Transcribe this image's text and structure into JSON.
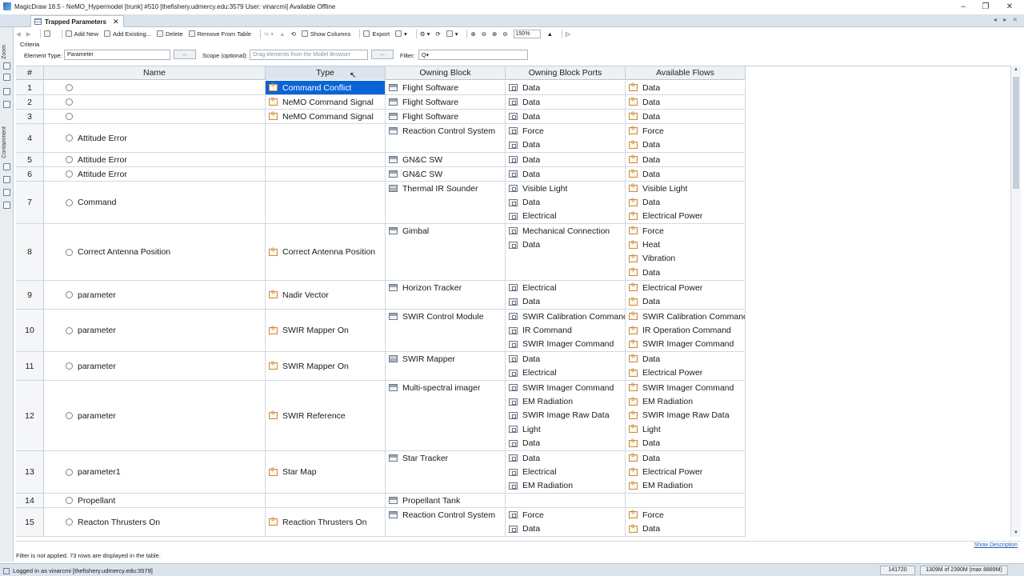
{
  "window": {
    "title": "MagicDraw 18.5 - NeMO_Hypermodel [trunk] #510  [thefishery.udmercy.edu:3579 User: vinarcmi] Available Offline",
    "controls": [
      "–",
      "❐",
      "✕"
    ]
  },
  "tab": {
    "label": "Trapped Parameters",
    "close": "✕"
  },
  "tabnav": "◂ ▸ ≡",
  "leftdock": {
    "zoom_label": "Zoom",
    "containment_label": "Containment"
  },
  "toolbar": {
    "add_new": "Add New",
    "add_existing": "Add Existing...",
    "delete": "Delete",
    "remove_from_table": "Remove From Table",
    "show_columns": "Show Columns",
    "export": "Export",
    "zoom": "150%"
  },
  "criteria": {
    "label": "Criteria",
    "element_type_label": "Element Type:",
    "element_type_value": "Parameter",
    "browse_button": "...",
    "scope_label": "Scope (optional):",
    "scope_placeholder": "Drag elements from the Model Browser",
    "scope_button": "...",
    "filter_label": "Filter:",
    "filter_value": "Q▾"
  },
  "table": {
    "columns": [
      "#",
      "Name",
      "Type",
      "Owning Block",
      "Owning Block Ports",
      "Available Flows"
    ],
    "rows": [
      {
        "num": "1",
        "name": "",
        "type": "Command Conflict",
        "type_icon": "signal",
        "selected": true,
        "block": [
          {
            "icon": "block",
            "text": "Flight Software"
          }
        ],
        "ports": [
          {
            "icon": "port",
            "text": "Data"
          }
        ],
        "flows": [
          {
            "icon": "flow",
            "text": "Data"
          }
        ]
      },
      {
        "num": "2",
        "name": "",
        "type": "NeMO Command Signal",
        "type_icon": "signal",
        "block": [
          {
            "icon": "block",
            "text": "Flight Software"
          }
        ],
        "ports": [
          {
            "icon": "port",
            "text": "Data"
          }
        ],
        "flows": [
          {
            "icon": "flow",
            "text": "Data"
          }
        ]
      },
      {
        "num": "3",
        "name": "",
        "type": "NeMO Command Signal",
        "type_icon": "signal",
        "block": [
          {
            "icon": "block",
            "text": "Flight Software"
          }
        ],
        "ports": [
          {
            "icon": "port",
            "text": "Data"
          }
        ],
        "flows": [
          {
            "icon": "flow",
            "text": "Data"
          }
        ]
      },
      {
        "num": "4",
        "name": "Attitude Error",
        "type": "",
        "type_icon": "",
        "block": [
          {
            "icon": "block",
            "text": "Reaction Control System"
          }
        ],
        "ports": [
          {
            "icon": "port",
            "text": "Force"
          },
          {
            "icon": "port",
            "text": "Data"
          }
        ],
        "flows": [
          {
            "icon": "flow",
            "text": "Force"
          },
          {
            "icon": "flow",
            "text": "Data"
          }
        ]
      },
      {
        "num": "5",
        "name": "Attitude Error",
        "type": "",
        "type_icon": "",
        "block": [
          {
            "icon": "block",
            "text": "GN&C SW"
          }
        ],
        "ports": [
          {
            "icon": "port",
            "text": "Data"
          }
        ],
        "flows": [
          {
            "icon": "flow",
            "text": "Data"
          }
        ]
      },
      {
        "num": "6",
        "name": "Attitude Error",
        "type": "",
        "type_icon": "",
        "block": [
          {
            "icon": "block",
            "text": "GN&C SW"
          }
        ],
        "ports": [
          {
            "icon": "port",
            "text": "Data"
          }
        ],
        "flows": [
          {
            "icon": "flow",
            "text": "Data"
          }
        ]
      },
      {
        "num": "7",
        "name": "Command",
        "type": "",
        "type_icon": "",
        "block": [
          {
            "icon": "sub",
            "text": "Thermal IR Sounder"
          }
        ],
        "ports": [
          {
            "icon": "port",
            "text": "Visible Light"
          },
          {
            "icon": "port",
            "text": "Data"
          },
          {
            "icon": "port",
            "text": "Electrical"
          }
        ],
        "flows": [
          {
            "icon": "flow",
            "text": "Visible Light"
          },
          {
            "icon": "flow",
            "text": "Data"
          },
          {
            "icon": "flow",
            "text": "Electrical Power"
          }
        ]
      },
      {
        "num": "8",
        "name": "Correct Antenna Position",
        "type": "Correct Antenna Position",
        "type_icon": "signal",
        "block": [
          {
            "icon": "block",
            "text": "Gimbal"
          }
        ],
        "ports": [
          {
            "icon": "port",
            "text": "Mechanical Connection"
          },
          {
            "icon": "port",
            "text": "Data"
          }
        ],
        "flows": [
          {
            "icon": "flow",
            "text": "Force"
          },
          {
            "icon": "flow",
            "text": "Heat"
          },
          {
            "icon": "flow",
            "text": "Vibration"
          },
          {
            "icon": "flow",
            "text": "Data"
          }
        ]
      },
      {
        "num": "9",
        "name": "parameter",
        "type": "Nadir Vector",
        "type_icon": "signal",
        "block": [
          {
            "icon": "block",
            "text": "Horizon Tracker"
          }
        ],
        "ports": [
          {
            "icon": "port",
            "text": "Electrical"
          },
          {
            "icon": "port",
            "text": "Data"
          }
        ],
        "flows": [
          {
            "icon": "flow",
            "text": "Electrical Power"
          },
          {
            "icon": "flow",
            "text": "Data"
          }
        ]
      },
      {
        "num": "10",
        "name": "parameter",
        "type": "SWIR Mapper On",
        "type_icon": "signal",
        "block": [
          {
            "icon": "block",
            "text": "SWIR Control Module"
          }
        ],
        "ports": [
          {
            "icon": "port",
            "text": "SWIR Calibration Command"
          },
          {
            "icon": "port",
            "text": "IR Command"
          },
          {
            "icon": "port",
            "text": "SWIR Imager Command"
          }
        ],
        "flows": [
          {
            "icon": "flow",
            "text": "SWIR Calibration Command"
          },
          {
            "icon": "flow",
            "text": "IR Operation Command"
          },
          {
            "icon": "flow",
            "text": "SWIR Imager Command"
          }
        ]
      },
      {
        "num": "11",
        "name": "parameter",
        "type": "SWIR Mapper On",
        "type_icon": "signal",
        "block": [
          {
            "icon": "sub",
            "text": "SWIR Mapper"
          }
        ],
        "ports": [
          {
            "icon": "port",
            "text": "Data"
          },
          {
            "icon": "port",
            "text": "Electrical"
          }
        ],
        "flows": [
          {
            "icon": "flow",
            "text": "Data"
          },
          {
            "icon": "flow",
            "text": "Electrical Power"
          }
        ]
      },
      {
        "num": "12",
        "name": "parameter",
        "type": "SWIR Reference",
        "type_icon": "signal",
        "block": [
          {
            "icon": "block",
            "text": "Multi-spectral imager"
          }
        ],
        "ports": [
          {
            "icon": "port",
            "text": "SWIR Imager Command"
          },
          {
            "icon": "port",
            "text": "EM Radiation"
          },
          {
            "icon": "port",
            "text": "SWIR Image Raw Data"
          },
          {
            "icon": "port",
            "text": "Light"
          },
          {
            "icon": "port",
            "text": "Data"
          }
        ],
        "flows": [
          {
            "icon": "flow",
            "text": "SWIR Imager Command"
          },
          {
            "icon": "flow",
            "text": "EM Radiation"
          },
          {
            "icon": "flow",
            "text": "SWIR Image Raw Data"
          },
          {
            "icon": "flow",
            "text": "Light"
          },
          {
            "icon": "flow",
            "text": "Data"
          }
        ]
      },
      {
        "num": "13",
        "name": "parameter1",
        "type": "Star Map",
        "type_icon": "enum",
        "block": [
          {
            "icon": "block",
            "text": "Star Tracker"
          }
        ],
        "ports": [
          {
            "icon": "port",
            "text": "Data"
          },
          {
            "icon": "port",
            "text": "Electrical"
          },
          {
            "icon": "port",
            "text": "EM Radiation"
          }
        ],
        "flows": [
          {
            "icon": "flow",
            "text": "Data"
          },
          {
            "icon": "flow",
            "text": "Electrical Power"
          },
          {
            "icon": "flow",
            "text": "EM Radiation"
          }
        ]
      },
      {
        "num": "14",
        "name": "Propellant",
        "type": "",
        "type_icon": "",
        "block": [
          {
            "icon": "block",
            "text": "Propellant Tank"
          }
        ],
        "ports": [],
        "flows": []
      },
      {
        "num": "15",
        "name": "Reacton Thrusters On",
        "type": "Reaction Thrusters On",
        "type_icon": "signal",
        "block": [
          {
            "icon": "block",
            "text": "Reaction Control System"
          }
        ],
        "ports": [
          {
            "icon": "port",
            "text": "Force"
          },
          {
            "icon": "port",
            "text": "Data"
          }
        ],
        "flows": [
          {
            "icon": "flow",
            "text": "Force"
          },
          {
            "icon": "flow",
            "text": "Data"
          }
        ]
      }
    ]
  },
  "footer": {
    "show_description": "Show Description",
    "filter_status": "Filter is not applied. 73 rows are displayed in the table.",
    "login": "Logged in as vinarcmi [thefishery.udmercy.edu:3579]",
    "counter": "141720",
    "memory": "1309M of 2390M (max 8889M)"
  }
}
